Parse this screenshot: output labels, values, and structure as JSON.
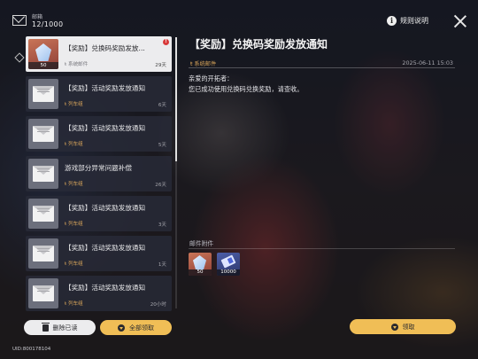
{
  "header": {
    "title": "邮箱",
    "count": "12/1000"
  },
  "top_right": {
    "rules_label": "规则说明"
  },
  "mail_list": [
    {
      "title": "【奖励】兑换码奖励发放...",
      "sender": "系统邮件",
      "days": "29天",
      "selected": true,
      "unread": true,
      "thumb": "crystal",
      "qty": "50"
    },
    {
      "title": "【奖励】活动奖励发放通知",
      "sender": "列车组",
      "days": "6天",
      "thumb": "envelope"
    },
    {
      "title": "【奖励】活动奖励发放通知",
      "sender": "列车组",
      "days": "5天",
      "thumb": "envelope"
    },
    {
      "title": "游戏部分异常问题补偿",
      "sender": "列车组",
      "days": "26天",
      "thumb": "envelope"
    },
    {
      "title": "【奖励】活动奖励发放通知",
      "sender": "列车组",
      "days": "3天",
      "thumb": "envelope"
    },
    {
      "title": "【奖励】活动奖励发放通知",
      "sender": "列车组",
      "days": "1天",
      "thumb": "envelope"
    },
    {
      "title": "【奖励】活动奖励发放通知",
      "sender": "列车组",
      "days": "20小时",
      "thumb": "envelope"
    }
  ],
  "buttons": {
    "delete_read": "删除已读",
    "claim_all": "全部领取",
    "claim": "领取"
  },
  "uid": "UID:800178104",
  "detail": {
    "title": "【奖励】兑换码奖励发放通知",
    "sender": "系统邮件",
    "date": "2025-06-11 15:03",
    "body_line1": "亲爱的开拓者：",
    "body_line2": "您已成功使用兑换码兑换奖励，请查收。",
    "attachments_label": "邮件附件",
    "attachments": [
      {
        "qty": "50"
      },
      {
        "qty": "10000"
      }
    ]
  }
}
